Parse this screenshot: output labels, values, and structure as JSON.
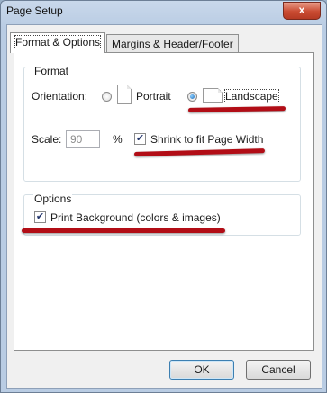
{
  "window": {
    "title": "Page Setup",
    "close_label": "x"
  },
  "tabs": [
    {
      "label": "Format & Options",
      "active": true
    },
    {
      "label": "Margins & Header/Footer",
      "active": false
    }
  ],
  "format_group": {
    "title": "Format",
    "orientation_label": "Orientation:",
    "portrait_label": "Portrait",
    "landscape_label": "Landscape",
    "selected": "landscape",
    "scale_label": "Scale:",
    "scale_value": "90",
    "percent_label": "%",
    "shrink_label": "Shrink to fit Page Width",
    "shrink_checked": true
  },
  "options_group": {
    "title": "Options",
    "print_background_label": "Print Background (colors & images)",
    "print_background_checked": true
  },
  "buttons": {
    "ok": "OK",
    "cancel": "Cancel"
  },
  "colors": {
    "annotation": "#b20d16",
    "accent": "#3c7fb1"
  }
}
